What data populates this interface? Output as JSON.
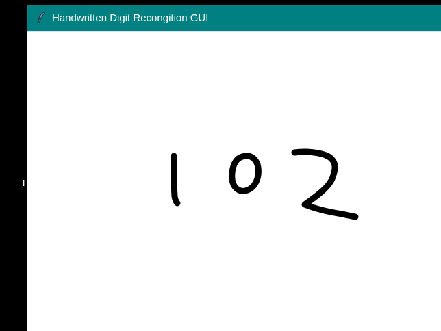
{
  "background_window": {
    "partial_text": "H"
  },
  "window": {
    "title": "Handwritten Digit Recongition GUI",
    "icon": "feather-icon",
    "titlebar_color": "#008080"
  },
  "canvas": {
    "background": "#ffffff",
    "stroke_color": "#000000",
    "drawn_digits": [
      "1",
      "0",
      "2"
    ]
  }
}
